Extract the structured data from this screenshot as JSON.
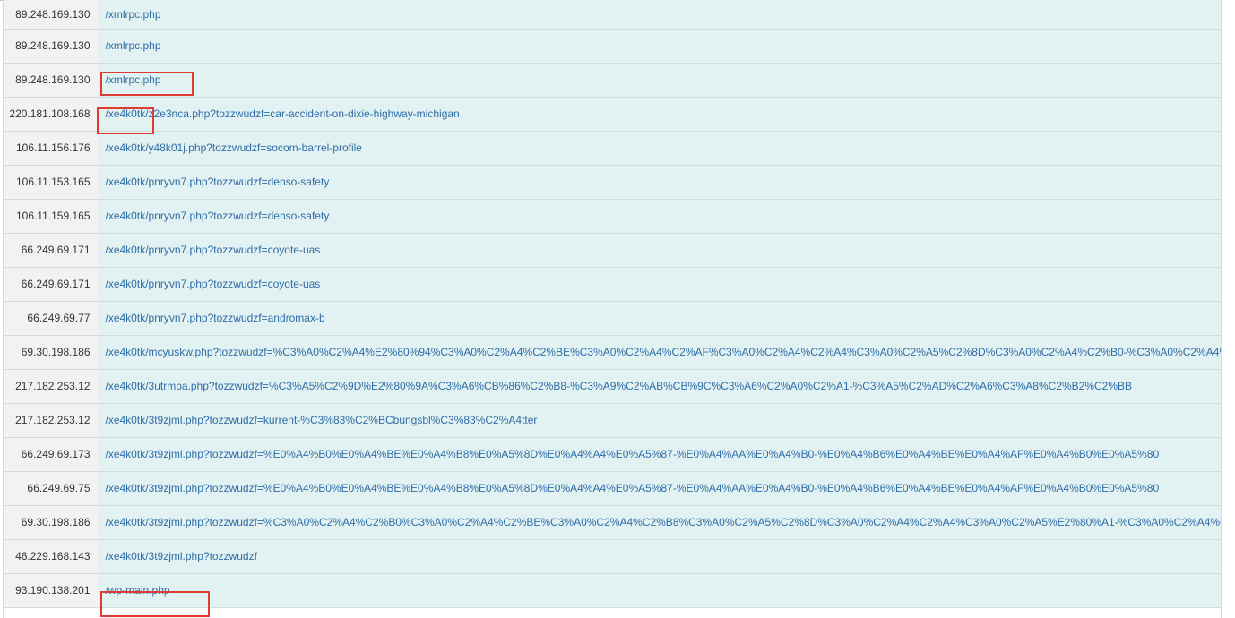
{
  "rows": [
    {
      "ip": "89.248.169.130",
      "url": "/xmlrpc.php"
    },
    {
      "ip": "89.248.169.130",
      "url": "/xmlrpc.php"
    },
    {
      "ip": "89.248.169.130",
      "url": "/xmlrpc.php"
    },
    {
      "ip": "220.181.108.168",
      "url": "/xe4k0tk/z2e3nca.php?tozzwudzf=car-accident-on-dixie-highway-michigan"
    },
    {
      "ip": "106.11.156.176",
      "url": "/xe4k0tk/y48k01j.php?tozzwudzf=socom-barrel-profile"
    },
    {
      "ip": "106.11.153.165",
      "url": "/xe4k0tk/pnryvn7.php?tozzwudzf=denso-safety"
    },
    {
      "ip": "106.11.159.165",
      "url": "/xe4k0tk/pnryvn7.php?tozzwudzf=denso-safety"
    },
    {
      "ip": "66.249.69.171",
      "url": "/xe4k0tk/pnryvn7.php?tozzwudzf=coyote-uas"
    },
    {
      "ip": "66.249.69.171",
      "url": "/xe4k0tk/pnryvn7.php?tozzwudzf=coyote-uas"
    },
    {
      "ip": "66.249.69.77",
      "url": "/xe4k0tk/pnryvn7.php?tozzwudzf=andromax-b"
    },
    {
      "ip": "69.30.198.186",
      "url": "/xe4k0tk/mcyuskw.php?tozzwudzf=%C3%A0%C2%A4%E2%80%94%C3%A0%C2%A4%C2%BE%C3%A0%C2%A4%C2%AF%C3%A0%C2%A4%C2%A4%C3%A0%C2%A5%C2%8D%C3%A0%C2%A4%C2%B0-%C3%A0%C2%A4%"
    },
    {
      "ip": "217.182.253.12",
      "url": "/xe4k0tk/3utrmpa.php?tozzwudzf=%C3%A5%C2%9D%E2%80%9A%C3%A6%CB%86%C2%B8-%C3%A9%C2%AB%CB%9C%C3%A6%C2%A0%C2%A1-%C3%A5%C2%AD%C2%A6%C3%A8%C2%B2%C2%BB"
    },
    {
      "ip": "217.182.253.12",
      "url": "/xe4k0tk/3t9zjml.php?tozzwudzf=kurrent-%C3%83%C2%BCbungsbl%C3%83%C2%A4tter"
    },
    {
      "ip": "66.249.69.173",
      "url": "/xe4k0tk/3t9zjml.php?tozzwudzf=%E0%A4%B0%E0%A4%BE%E0%A4%B8%E0%A5%8D%E0%A4%A4%E0%A5%87-%E0%A4%AA%E0%A4%B0-%E0%A4%B6%E0%A4%BE%E0%A4%AF%E0%A4%B0%E0%A5%80"
    },
    {
      "ip": "66.249.69.75",
      "url": "/xe4k0tk/3t9zjml.php?tozzwudzf=%E0%A4%B0%E0%A4%BE%E0%A4%B8%E0%A5%8D%E0%A4%A4%E0%A5%87-%E0%A4%AA%E0%A4%B0-%E0%A4%B6%E0%A4%BE%E0%A4%AF%E0%A4%B0%E0%A5%80"
    },
    {
      "ip": "69.30.198.186",
      "url": "/xe4k0tk/3t9zjml.php?tozzwudzf=%C3%A0%C2%A4%C2%B0%C3%A0%C2%A4%C2%BE%C3%A0%C2%A4%C2%B8%C3%A0%C2%A5%C2%8D%C3%A0%C2%A4%C2%A4%C3%A0%C2%A5%E2%80%A1-%C3%A0%C2%A4%C"
    },
    {
      "ip": "46.229.168.143",
      "url": "/xe4k0tk/3t9zjml.php?tozzwudzf"
    },
    {
      "ip": "93.190.138.201",
      "url": "/wp-main.php"
    }
  ],
  "highlight_color": "#de3b32",
  "link_color": "#2f6ea8"
}
